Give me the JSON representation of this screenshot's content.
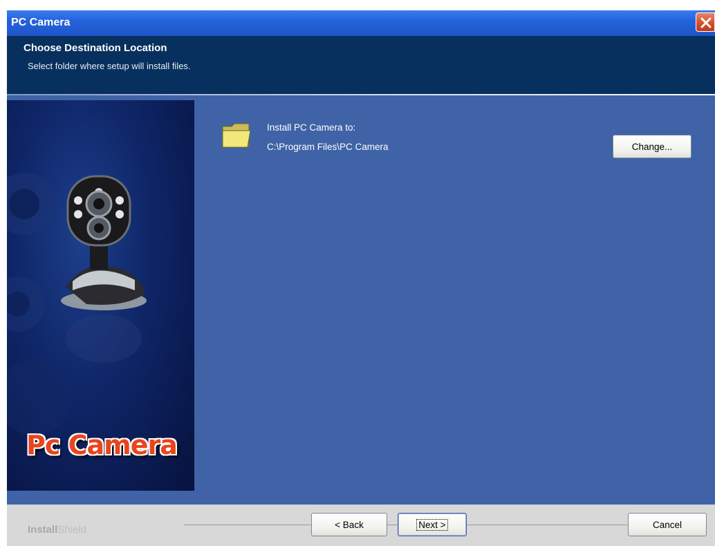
{
  "window": {
    "title": "PC Camera"
  },
  "header": {
    "title": "Choose Destination Location",
    "subtitle": "Select folder where setup will install files."
  },
  "banner": {
    "text": "Pc Camera"
  },
  "content": {
    "install_label": "Install PC Camera to:",
    "install_path": "C:\\Program Files\\PC Camera",
    "change_label": "Change..."
  },
  "footer": {
    "brand_a": "Install",
    "brand_b": "Shield",
    "back_label": "< Back",
    "next_label": "Next >",
    "cancel_label": "Cancel"
  },
  "colors": {
    "dialog_bg": "#3f63a6",
    "header_bg": "#08305e",
    "title_bar": "#2563dc",
    "banner_text": "#e8451e"
  },
  "icons": [
    "close-icon",
    "folder-icon",
    "webcam-image"
  ]
}
